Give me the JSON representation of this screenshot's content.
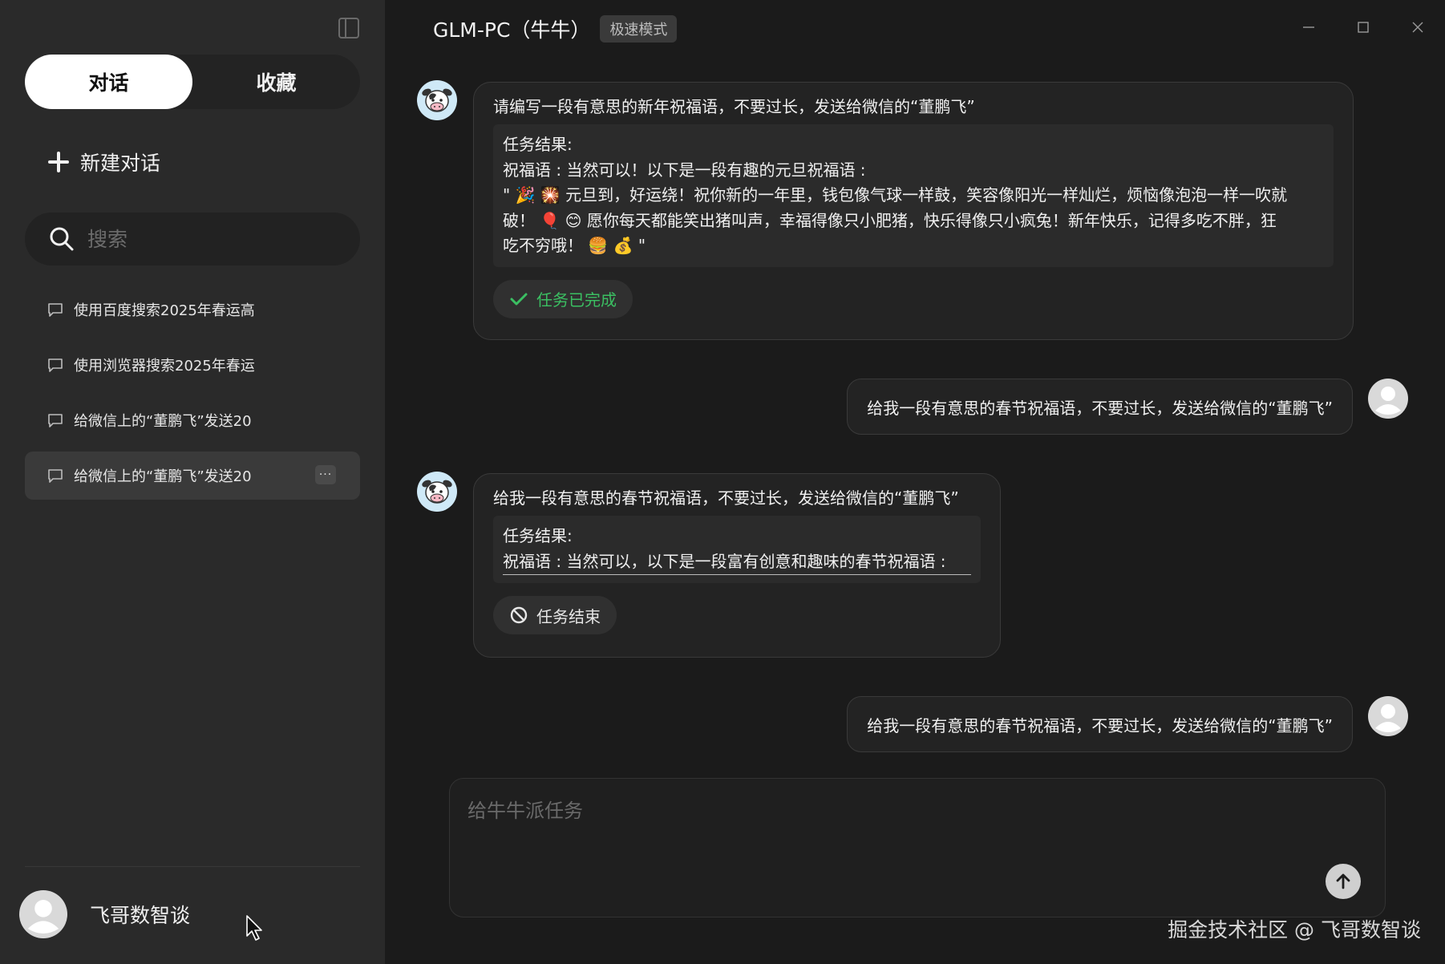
{
  "sidebar": {
    "mode_tabs": [
      "对话",
      "收藏"
    ],
    "new_chat_label": "新建对话",
    "search_placeholder": "搜索",
    "history": [
      "使用百度搜索2025年春运高",
      "使用浏览器搜索2025年春运",
      "给微信上的“董鹏飞”发送20",
      "给微信上的“董鹏飞”发送20"
    ],
    "more_label": "···",
    "user_name": "飞哥数智谈"
  },
  "header": {
    "title": "GLM-PC（牛牛）",
    "mode_badge": "极速模式"
  },
  "conversation": {
    "msg1": {
      "prompt": "请编写一段有意思的新年祝福语，不要过长，发送给微信的“董鹏飞”",
      "result_heading": "任务结果:",
      "result_line1": "祝福语 : 当然可以！以下是一段有趣的元旦祝福语 :",
      "result_line2": "\" 🎉 🎇 元旦到，好运绕！祝你新的一年里，钱包像气球一样鼓，笑容像阳光一样灿烂，烦恼像泡泡一样一吹就",
      "result_line3": "破！ 🎈 😊 愿你每天都能笑出猪叫声，幸福得像只小肥猪，快乐得像只小疯兔！新年快乐，记得多吃不胖，狂",
      "result_line4": "吃不穷哦！ 🍔 💰 \"",
      "status": "任务已完成"
    },
    "user_msg1": "给我一段有意思的春节祝福语，不要过长，发送给微信的“董鹏飞”",
    "msg2": {
      "prompt": "给我一段有意思的春节祝福语，不要过长，发送给微信的“董鹏飞”",
      "result_heading": "任务结果:",
      "result_line1": "祝福语 : 当然可以，以下是一段富有创意和趣味的春节祝福语 :",
      "status": "任务结束"
    },
    "user_msg2": "给我一段有意思的春节祝福语，不要过长，发送给微信的“董鹏飞”"
  },
  "input": {
    "placeholder": "给牛牛派任务"
  },
  "watermark": "掘金技术社区 @ 飞哥数智谈",
  "colors": {
    "sidebar_bg": "#2a2a2a",
    "main_bg": "#1b1b1b",
    "success": "#3bbf62"
  },
  "icons": [
    "sidebar-toggle-icon",
    "plus-icon",
    "search-icon",
    "chat-icon",
    "check-icon",
    "ban-icon",
    "arrow-up-icon",
    "minimize-icon",
    "maximize-icon",
    "close-icon",
    "cow-avatar",
    "user-avatar"
  ]
}
